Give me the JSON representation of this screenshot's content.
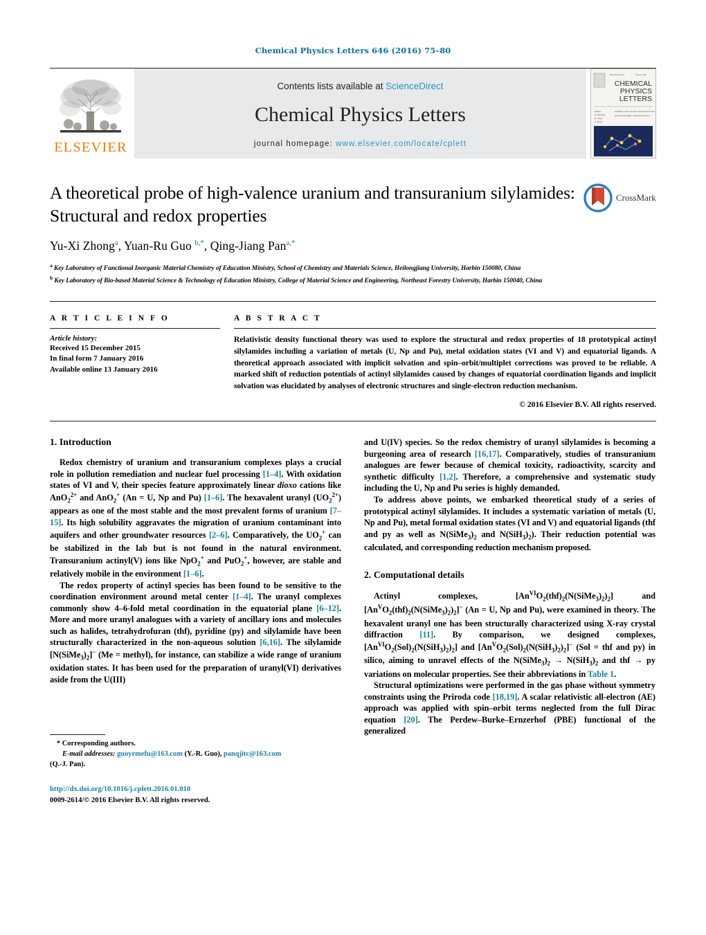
{
  "running_head": "Chemical Physics Letters 646 (2016) 75–80",
  "masthead": {
    "contents_prefix": "Contents lists available at ",
    "contents_link": "ScienceDirect",
    "journal_title": "Chemical Physics Letters",
    "homepage_label": "journal homepage:",
    "homepage_url": "www.elsevier.com/locate/cplett",
    "publisher_logo_text": "ELSEVIER",
    "cover_lines": [
      "CHEMICAL",
      "PHYSICS",
      "LETTERS"
    ],
    "link_color": "#2a94c6",
    "logo_color": "#f07d00"
  },
  "article": {
    "title": "A theoretical probe of high-valence uranium and transuranium silylamides: Structural and redox properties",
    "authors_html": "Yu-Xi Zhong<sup>a</sup>, Yuan-Ru Guo<sup>b,*</sup>, Qing-Jiang Pan<sup>a,*</sup>",
    "authors_plain": "Yu-Xi Zhong a, Yuan-Ru Guo b,*, Qing-Jiang Pan a,*",
    "affiliations": [
      {
        "marker": "a",
        "text": "Key Laboratory of Functional Inorganic Material Chemistry of Education Ministry, School of Chemistry and Materials Science, Heilongjiang University, Harbin 150080, China"
      },
      {
        "marker": "b",
        "text": "Key Laboratory of Bio-based Material Science & Technology of Education Ministry, College of Material Science and Engineering, Northeast Forestry University, Harbin 150040, China"
      }
    ],
    "crossmark_label": "CrossMark"
  },
  "article_info": {
    "heading": "A R T I C L E   I N F O",
    "history_label": "Article history:",
    "history": [
      "Received 15 December 2015",
      "In final form 7 January 2016",
      "Available online 13 January 2016"
    ]
  },
  "abstract": {
    "heading": "A B S T R A C T",
    "text": "Relativistic density functional theory was used to explore the structural and redox properties of 18 prototypical actinyl silylamides including a variation of metals (U, Np and Pu), metal oxidation states (VI and V) and equatorial ligands. A theoretical approach associated with implicit solvation and spin–orbit/multiplet corrections was proved to be reliable. A marked shift of reduction potentials of actinyl silylamides caused by changes of equatorial coordination ligands and implicit solvation was elucidated by analyses of electronic structures and single-electron reduction mechanism.",
    "copyright": "© 2016 Elsevier B.V. All rights reserved."
  },
  "sections": {
    "intro_heading": "1.  Introduction",
    "computational_heading": "2.  Computational details"
  },
  "footnotes": {
    "corresponding": "*  Corresponding authors.",
    "email_label": "E-mail addresses:",
    "email1": "guoyrmefu@163.com",
    "email1_owner": "(Y.-R. Guo),",
    "email2": "panqjitc@163.com",
    "email2_owner": "(Q.-J. Pan).",
    "doi": "http://dx.doi.org/10.1016/j.cplett.2016.01.010",
    "issn": "0009-2614/© 2016 Elsevier B.V. All rights reserved."
  }
}
